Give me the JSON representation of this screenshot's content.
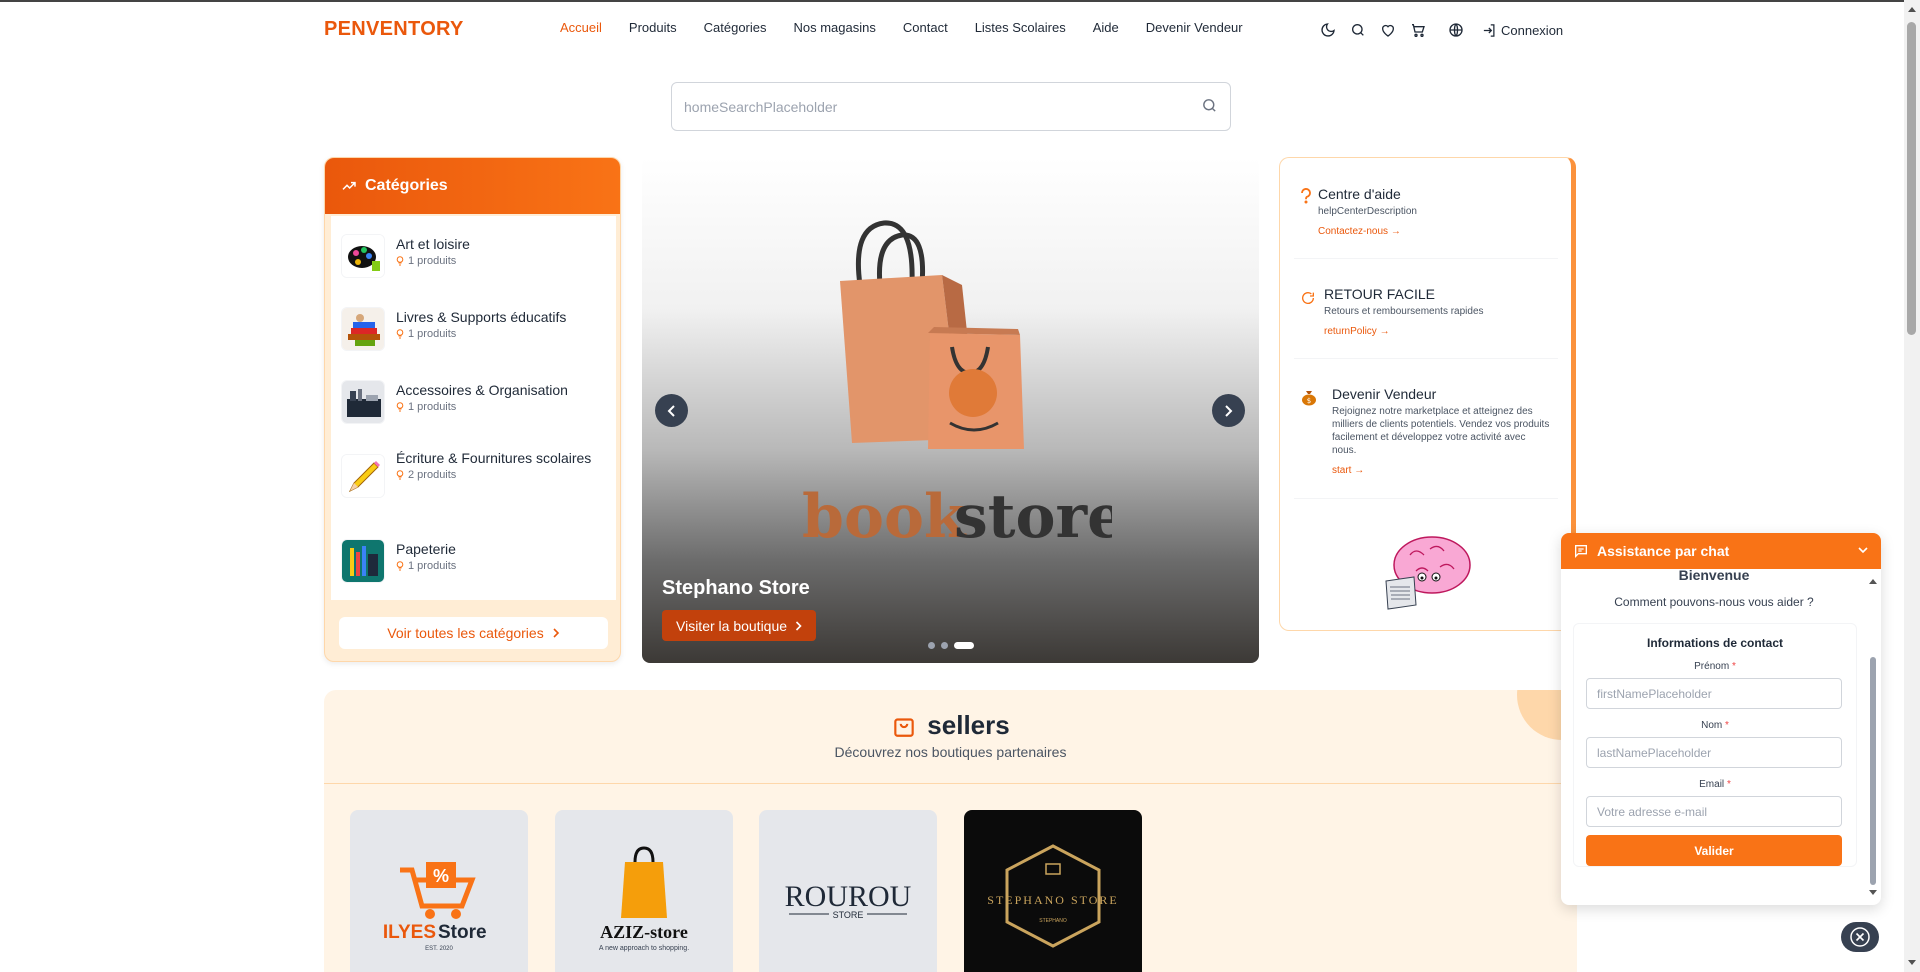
{
  "header": {
    "logo": "PENVENTORY",
    "nav": [
      {
        "label": "Accueil",
        "active": true
      },
      {
        "label": "Produits"
      },
      {
        "label": "Catégories"
      },
      {
        "label": "Nos magasins"
      },
      {
        "label": "Contact"
      },
      {
        "label": "Listes Scolaires"
      },
      {
        "label": "Aide"
      },
      {
        "label": "Devenir Vendeur"
      }
    ],
    "icons": [
      "moon-icon",
      "search-icon",
      "heart-icon",
      "cart-icon",
      "globe-icon"
    ],
    "login_label": "Connexion"
  },
  "search": {
    "placeholder": "homeSearchPlaceholder"
  },
  "categories": {
    "title": "Catégories",
    "items": [
      {
        "name": "Art et loisire",
        "count": "1 produits"
      },
      {
        "name": "Livres & Supports éducatifs",
        "count": "1 produits"
      },
      {
        "name": "Accessoires & Organisation",
        "count": "1 produits"
      },
      {
        "name": "Écriture & Fournitures scolaires",
        "count": "2 produits"
      },
      {
        "name": "Papeterie",
        "count": "1 produits"
      }
    ],
    "see_all": "Voir toutes les catégories"
  },
  "hero": {
    "logo_text_left": "book",
    "logo_text_right": "store",
    "store_name": "Stephano Store",
    "button_label": "Visiter la boutique",
    "slide_count": 3,
    "active_slide": 3
  },
  "info": {
    "help": {
      "title": "Centre d'aide",
      "desc": "helpCenterDescription",
      "link": "Contactez-nous →"
    },
    "returns": {
      "title": "RETOUR FACILE",
      "desc": "Retours et remboursements rapides",
      "link": "returnPolicy →"
    },
    "seller": {
      "title": "Devenir Vendeur",
      "desc": "Rejoignez notre marketplace et atteignez des milliers de clients potentiels. Vendez vos produits facilement et développez votre activité avec nous.",
      "link": "start →"
    }
  },
  "sellers": {
    "title": "sellers",
    "subtitle": "Découvrez nos boutiques partenaires",
    "stores": [
      {
        "name": "ILYES Store",
        "main": "ILYES",
        "accent": "Store",
        "tagline": "EST. 2020"
      },
      {
        "name": "AZIZ-store",
        "main": "AZIZ-store",
        "tagline": "A new approach to shopping."
      },
      {
        "name": "ROUROU STORE",
        "main": "ROUROU",
        "tagline": "STORE"
      },
      {
        "name": "STEPHANO STORE",
        "main": "STEPHANO STORE",
        "tagline": "STEPHANO"
      }
    ]
  },
  "chat": {
    "title": "Assistance par chat",
    "welcome": "Bienvenue",
    "question": "Comment pouvons-nous vous aider ?",
    "contact_title": "Informations de contact",
    "fields": [
      {
        "label": "Prénom",
        "required": "*",
        "placeholder": "firstNamePlaceholder"
      },
      {
        "label": "Nom",
        "required": "*",
        "placeholder": "lastNamePlaceholder"
      },
      {
        "label": "Email",
        "required": "*",
        "placeholder": "Votre adresse e-mail"
      }
    ],
    "submit": "Valider"
  },
  "colors": {
    "accent": "#ea580c",
    "accent_light": "#f97316",
    "panel_bg": "#ffedd5",
    "dark": "#374151"
  }
}
